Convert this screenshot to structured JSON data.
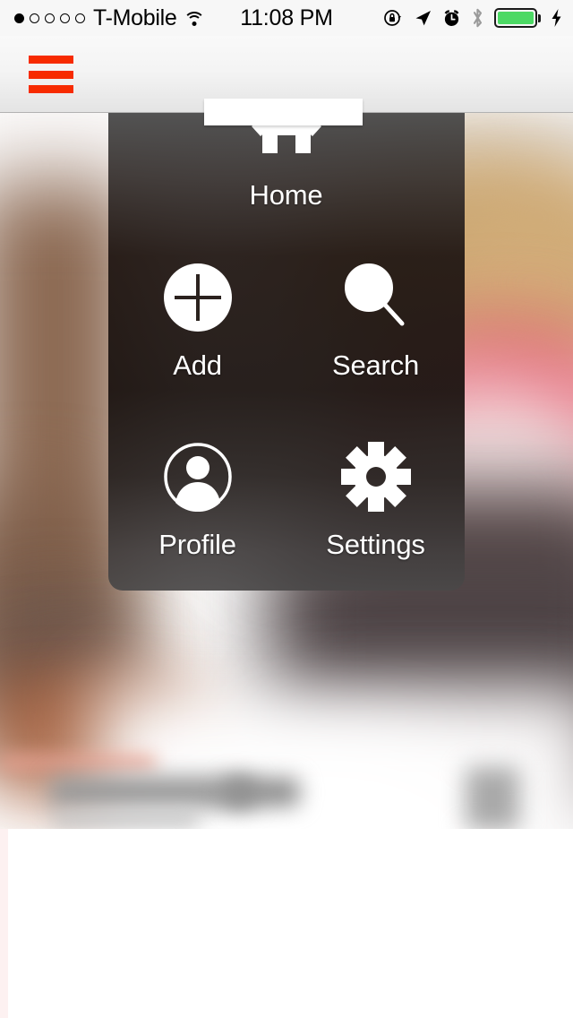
{
  "status_bar": {
    "carrier": "T-Mobile",
    "time": "11:08 PM",
    "signal_dots_total": 5,
    "signal_dots_filled": 1,
    "icons": [
      "wifi-icon",
      "rotation-lock-icon",
      "location-arrow-icon",
      "alarm-clock-icon",
      "bluetooth-icon",
      "battery-icon",
      "charging-bolt-icon"
    ],
    "battery_color": "#4CD964",
    "bluetooth_color": "#9a9a9a"
  },
  "nav_bar": {
    "menu_button_name": "hamburger-menu",
    "menu_button_color": "#f72b00",
    "logo_placeholder_color": "#ffffff"
  },
  "menu_overlay": {
    "items": [
      {
        "label": "Home",
        "icon": "home-icon"
      },
      {
        "label": "Add",
        "icon": "plus-circle-icon"
      },
      {
        "label": "Search",
        "icon": "magnifier-icon"
      },
      {
        "label": "Profile",
        "icon": "person-circle-icon"
      },
      {
        "label": "Settings",
        "icon": "gear-icon"
      }
    ],
    "text_color": "#ffffff",
    "scrim_color": "#231814"
  },
  "background": {
    "description": "blurred photo content behind overlay"
  }
}
